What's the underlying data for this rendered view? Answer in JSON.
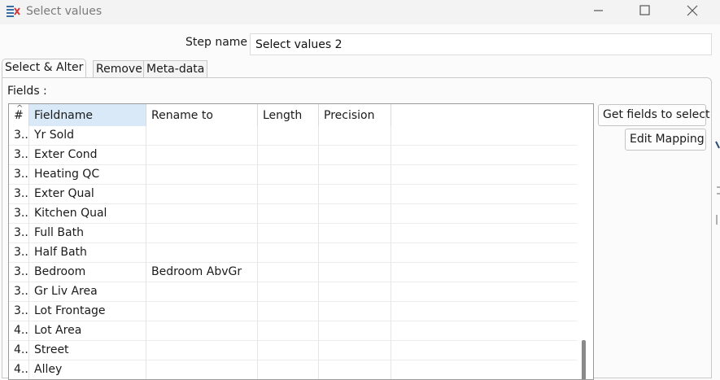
{
  "window": {
    "title": "Select values",
    "controls": {
      "minimize": "minimize-icon",
      "maximize": "maximize-icon",
      "close": "close-icon"
    }
  },
  "step": {
    "label": "Step name",
    "value": "Select values 2"
  },
  "tabs": [
    {
      "label": "Select & Alter",
      "active": true
    },
    {
      "label": "Remove",
      "active": false
    },
    {
      "label": "Meta-data",
      "active": false
    }
  ],
  "fields_label": "Fields :",
  "table": {
    "columns": [
      "#",
      "Fieldname",
      "Rename to",
      "Length",
      "Precision",
      ""
    ],
    "rows": [
      {
        "num": "3..",
        "fieldname": "Yr Sold",
        "rename": "",
        "length": "",
        "precision": ""
      },
      {
        "num": "3..",
        "fieldname": "Exter Cond",
        "rename": "",
        "length": "",
        "precision": ""
      },
      {
        "num": "3..",
        "fieldname": "Heating QC",
        "rename": "",
        "length": "",
        "precision": ""
      },
      {
        "num": "3..",
        "fieldname": "Exter Qual",
        "rename": "",
        "length": "",
        "precision": ""
      },
      {
        "num": "3..",
        "fieldname": "Kitchen Qual",
        "rename": "",
        "length": "",
        "precision": ""
      },
      {
        "num": "3..",
        "fieldname": "Full Bath",
        "rename": "",
        "length": "",
        "precision": ""
      },
      {
        "num": "3..",
        "fieldname": "Half Bath",
        "rename": "",
        "length": "",
        "precision": ""
      },
      {
        "num": "3..",
        "fieldname": "Bedroom",
        "rename": "Bedroom AbvGr",
        "length": "",
        "precision": ""
      },
      {
        "num": "3..",
        "fieldname": "Gr Liv Area",
        "rename": "",
        "length": "",
        "precision": ""
      },
      {
        "num": "3..",
        "fieldname": "Lot Frontage",
        "rename": "",
        "length": "",
        "precision": ""
      },
      {
        "num": "4..",
        "fieldname": "Lot Area",
        "rename": "",
        "length": "",
        "precision": ""
      },
      {
        "num": "4..",
        "fieldname": "Street",
        "rename": "",
        "length": "",
        "precision": ""
      },
      {
        "num": "4..",
        "fieldname": "Alley",
        "rename": "",
        "length": "",
        "precision": ""
      }
    ]
  },
  "buttons": {
    "get_fields": "Get fields to select",
    "edit_mapping": "Edit Mapping"
  },
  "colors": {
    "selected_header": "#d9e9f7",
    "icon_red": "#d23b3b",
    "icon_blue": "#3a6ea5"
  }
}
